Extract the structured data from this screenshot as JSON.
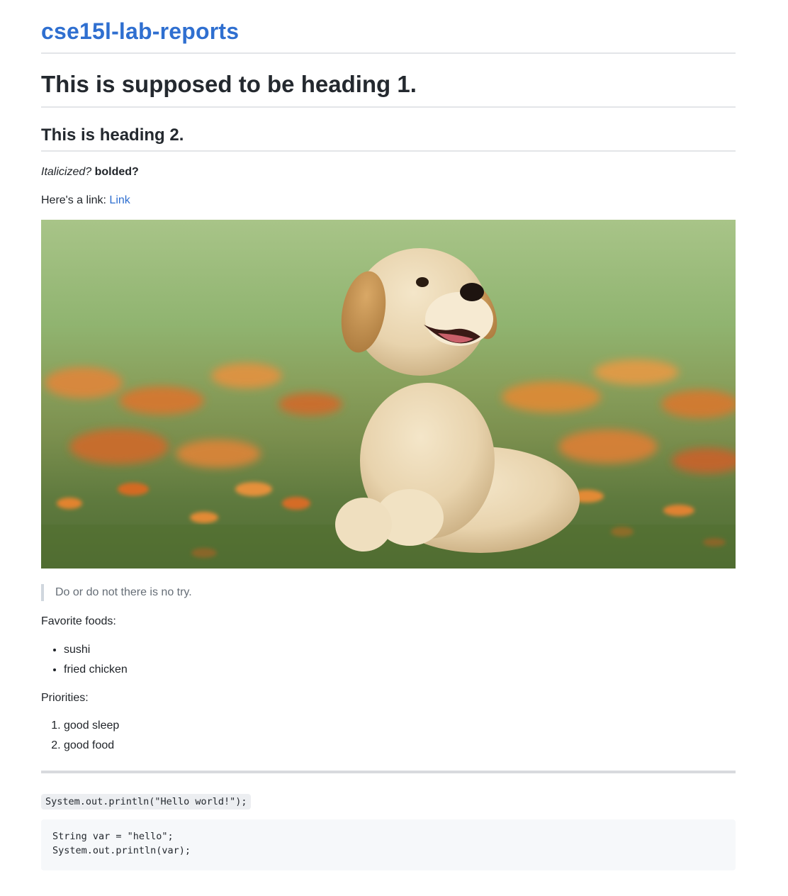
{
  "site": {
    "title": "cse15l-lab-reports"
  },
  "content": {
    "heading1": "This is supposed to be heading 1.",
    "heading2": "This is heading 2.",
    "italic_text": "Italicized?",
    "bold_text": "bolded?",
    "link_prefix": "Here's a link: ",
    "link_text": "Link",
    "image_alt": "Golden retriever puppy sitting in grass with orange flowers",
    "blockquote": "Do or do not there is no try.",
    "foods_label": "Favorite foods:",
    "foods": [
      "sushi",
      "fried chicken"
    ],
    "priorities_label": "Priorities:",
    "priorities": [
      "good sleep",
      "good food"
    ],
    "inline_code": "System.out.println(\"Hello world!\");",
    "code_block_lines": [
      "String var = \"hello\";",
      "System.out.println(var);"
    ]
  }
}
